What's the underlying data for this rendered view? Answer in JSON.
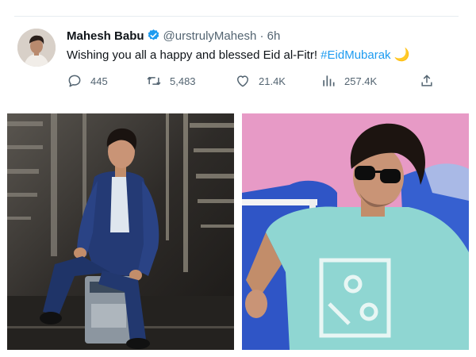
{
  "tweet": {
    "author_name": "Mahesh Babu",
    "handle": "@urstrulyMahesh",
    "separator": "·",
    "time": "6h",
    "text_prefix": "Wishing you all a happy and blessed Eid al-Fitr! ",
    "hashtag": "#EidMubarak",
    "emoji": "🌙",
    "verified_color": "#1d9bf0",
    "hashtag_color": "#1d9bf0"
  },
  "actions": {
    "replies": "445",
    "retweets": "5,483",
    "likes": "21.4K",
    "views": "257.4K"
  },
  "icons": {
    "reply": "reply-icon",
    "retweet": "retweet-icon",
    "like": "heart-icon",
    "views": "views-icon",
    "share": "share-icon",
    "verified": "verified-badge-icon"
  },
  "media": {
    "photo_1": "man-in-blue-suit-seated-photo",
    "photo_2": "man-in-teal-tshirt-sunglasses-photo"
  }
}
